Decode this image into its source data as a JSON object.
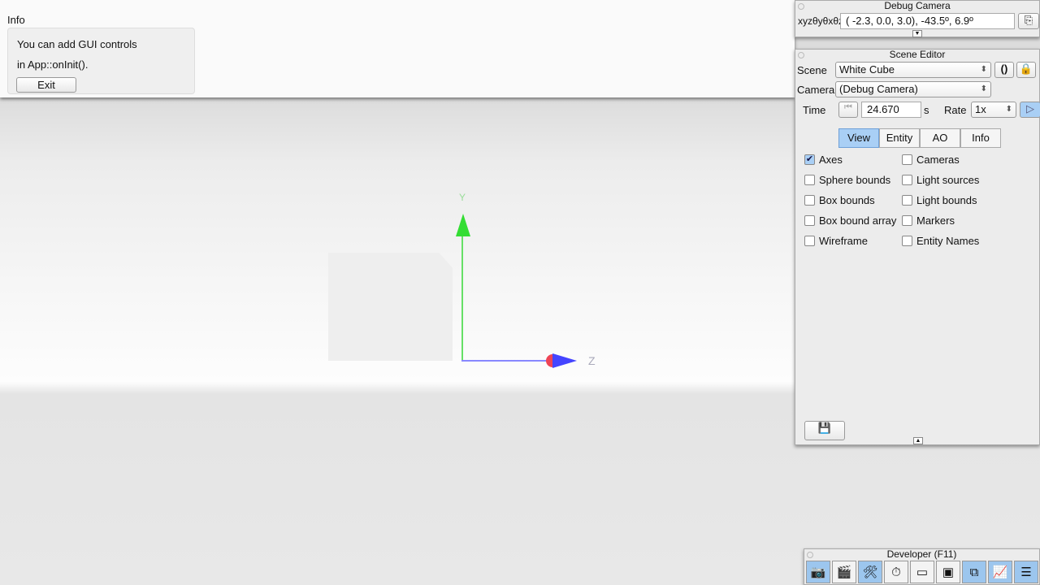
{
  "info": {
    "title": "Info",
    "line1": "You can add GUI controls",
    "line2": "in App::onInit().",
    "exit": "Exit"
  },
  "axes": {
    "y": "Y",
    "z": "Z"
  },
  "debug_camera": {
    "title": "Debug Camera",
    "label": "xyzθyθxθz",
    "value": "( -2.3,   0.0,   3.0), -43.5º,   6.9º"
  },
  "scene_editor": {
    "title": "Scene Editor",
    "scene_label": "Scene",
    "scene_value": "White Cube",
    "camera_label": "Camera",
    "camera_value": "(Debug Camera)",
    "time_label": "Time",
    "time_value": "24.670",
    "time_unit": "s",
    "rate_label": "Rate",
    "rate_value": "1x",
    "tabs": [
      {
        "label": "View",
        "active": true
      },
      {
        "label": "Entity"
      },
      {
        "label": "AO"
      },
      {
        "label": "Info"
      }
    ],
    "checks": [
      {
        "label": "Axes",
        "checked": true
      },
      {
        "label": "Cameras"
      },
      {
        "label": "Sphere bounds"
      },
      {
        "label": "Light sources"
      },
      {
        "label": "Box bounds"
      },
      {
        "label": "Light bounds"
      },
      {
        "label": "Box bound array"
      },
      {
        "label": "Markers"
      },
      {
        "label": "Wireframe"
      },
      {
        "label": "Entity Names"
      }
    ]
  },
  "developer": {
    "title": "Developer (F11)",
    "tools": [
      {
        "icon": "camera-icon",
        "on": true
      },
      {
        "icon": "clapperboard-icon"
      },
      {
        "icon": "tools-icon",
        "on": true
      },
      {
        "icon": "profiler-icon"
      },
      {
        "icon": "window-icon"
      },
      {
        "icon": "console-icon"
      },
      {
        "icon": "scene-icon",
        "on": true
      },
      {
        "icon": "stats-icon",
        "on": true
      },
      {
        "icon": "log-icon",
        "on": true
      }
    ]
  }
}
